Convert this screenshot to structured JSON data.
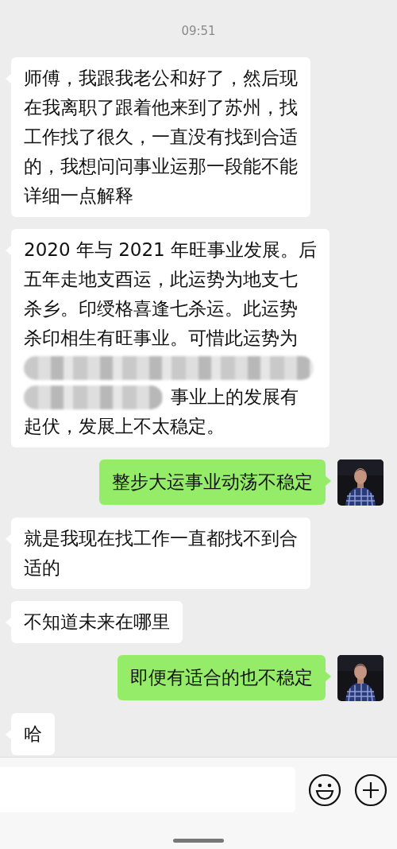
{
  "time": "09:51",
  "messages": [
    {
      "kind": "received",
      "lines": [
        {
          "text": "师傅，我跟我老公和好了，然后现",
          "redacted": false
        },
        {
          "text": "在我离职了跟着他来到了苏州，找",
          "redacted": false
        },
        {
          "text": "工作找了很久，一直没有找到合适",
          "redacted": false
        },
        {
          "text": "的，我想问问事业运那一段能不能",
          "redacted": false
        },
        {
          "text": "详细一点解释",
          "redacted": false
        }
      ]
    },
    {
      "kind": "received",
      "lines": [
        {
          "text": "2020 年与 2021 年旺事业发展。后",
          "redacted": false
        },
        {
          "text": "五年走地支酉运，此运势为地支七",
          "redacted": false
        },
        {
          "text": "杀乡。印绶格喜逢七杀运。此运势",
          "redacted": false
        },
        {
          "text": "杀印相生有旺事业。可惜此运势为",
          "redacted": false
        },
        {
          "redacted": true
        },
        {
          "text": "事业上的发展有",
          "redacted": true
        },
        {
          "text": "起伏，发展上不太稳定。",
          "redacted": false
        }
      ]
    },
    {
      "kind": "sent",
      "lines": [
        {
          "text": "整步大运事业动荡不稳定",
          "redacted": false
        }
      ]
    },
    {
      "kind": "received",
      "lines": [
        {
          "text": "就是我现在找工作一直都找不到合",
          "redacted": false
        },
        {
          "text": "适的",
          "redacted": false
        }
      ]
    },
    {
      "kind": "received",
      "lines": [
        {
          "text": "不知道未来在哪里",
          "redacted": false
        }
      ]
    },
    {
      "kind": "sent",
      "lines": [
        {
          "text": "即便有适合的也不稳定",
          "redacted": false
        }
      ]
    },
    {
      "kind": "received",
      "lines": [
        {
          "text": "哈",
          "redacted": false
        }
      ]
    }
  ]
}
